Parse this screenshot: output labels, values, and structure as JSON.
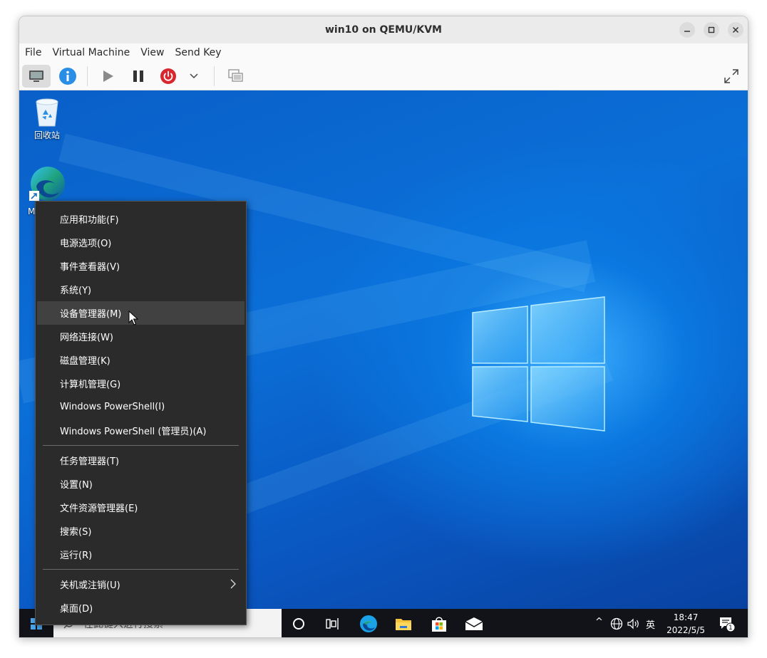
{
  "window": {
    "title": "win10 on QEMU/KVM",
    "minimize_icon": "minimize-icon",
    "maximize_icon": "maximize-icon",
    "close_icon": "close-icon"
  },
  "menubar": {
    "items": [
      "File",
      "Virtual Machine",
      "View",
      "Send Key"
    ]
  },
  "toolbar": {
    "buttons": [
      "console-icon",
      "details-info-icon",
      "run-icon",
      "pause-icon",
      "shutdown-icon",
      "dropdown-chevron-icon",
      "snapshots-icon",
      "fullscreen-icon"
    ],
    "accent_blue": "#2a8ee6",
    "power_red": "#d9262e"
  },
  "desktop": {
    "icons": [
      {
        "label": "回收站",
        "icon": "recycle-bin-icon"
      },
      {
        "label": "M",
        "icon": "edge-browser-icon"
      }
    ]
  },
  "context_menu": {
    "group1": [
      "应用和功能(F)",
      "电源选项(O)",
      "事件查看器(V)",
      "系统(Y)",
      "设备管理器(M)",
      "网络连接(W)",
      "磁盘管理(K)",
      "计算机管理(G)",
      "Windows PowerShell(I)",
      "Windows PowerShell (管理员)(A)"
    ],
    "group2": [
      "任务管理器(T)",
      "设置(N)",
      "文件资源管理器(E)",
      "搜索(S)",
      "运行(R)"
    ],
    "group3": [
      "关机或注销(U)",
      "桌面(D)"
    ],
    "hovered_item": "设备管理器(M)"
  },
  "taskbar": {
    "search_placeholder": "在此键入进行搜索",
    "pinned": [
      "cortana-circle-icon",
      "task-view-icon",
      "edge-icon",
      "file-explorer-icon",
      "store-icon",
      "mail-icon"
    ],
    "tray": {
      "chevron": "^",
      "input_method": "英",
      "time": "18:47",
      "date": "2022/5/5",
      "notification_count": "1"
    }
  }
}
